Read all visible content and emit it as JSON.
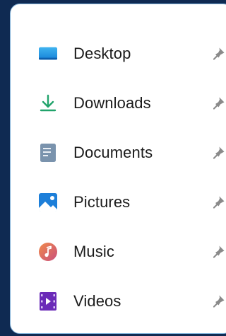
{
  "quick_access": {
    "items": [
      {
        "label": "Desktop",
        "icon": "desktop-folder-icon",
        "pinned": true
      },
      {
        "label": "Downloads",
        "icon": "downloads-arrow-icon",
        "pinned": true
      },
      {
        "label": "Documents",
        "icon": "documents-icon",
        "pinned": true
      },
      {
        "label": "Pictures",
        "icon": "pictures-icon",
        "pinned": true
      },
      {
        "label": "Music",
        "icon": "music-icon",
        "pinned": true
      },
      {
        "label": "Videos",
        "icon": "videos-icon",
        "pinned": true
      }
    ]
  },
  "colors": {
    "background": "#0f2a52",
    "panel": "#ffffff",
    "panel_border": "#7fb0d8",
    "text": "#1b1b1b",
    "pin": "#8a8a8a"
  }
}
